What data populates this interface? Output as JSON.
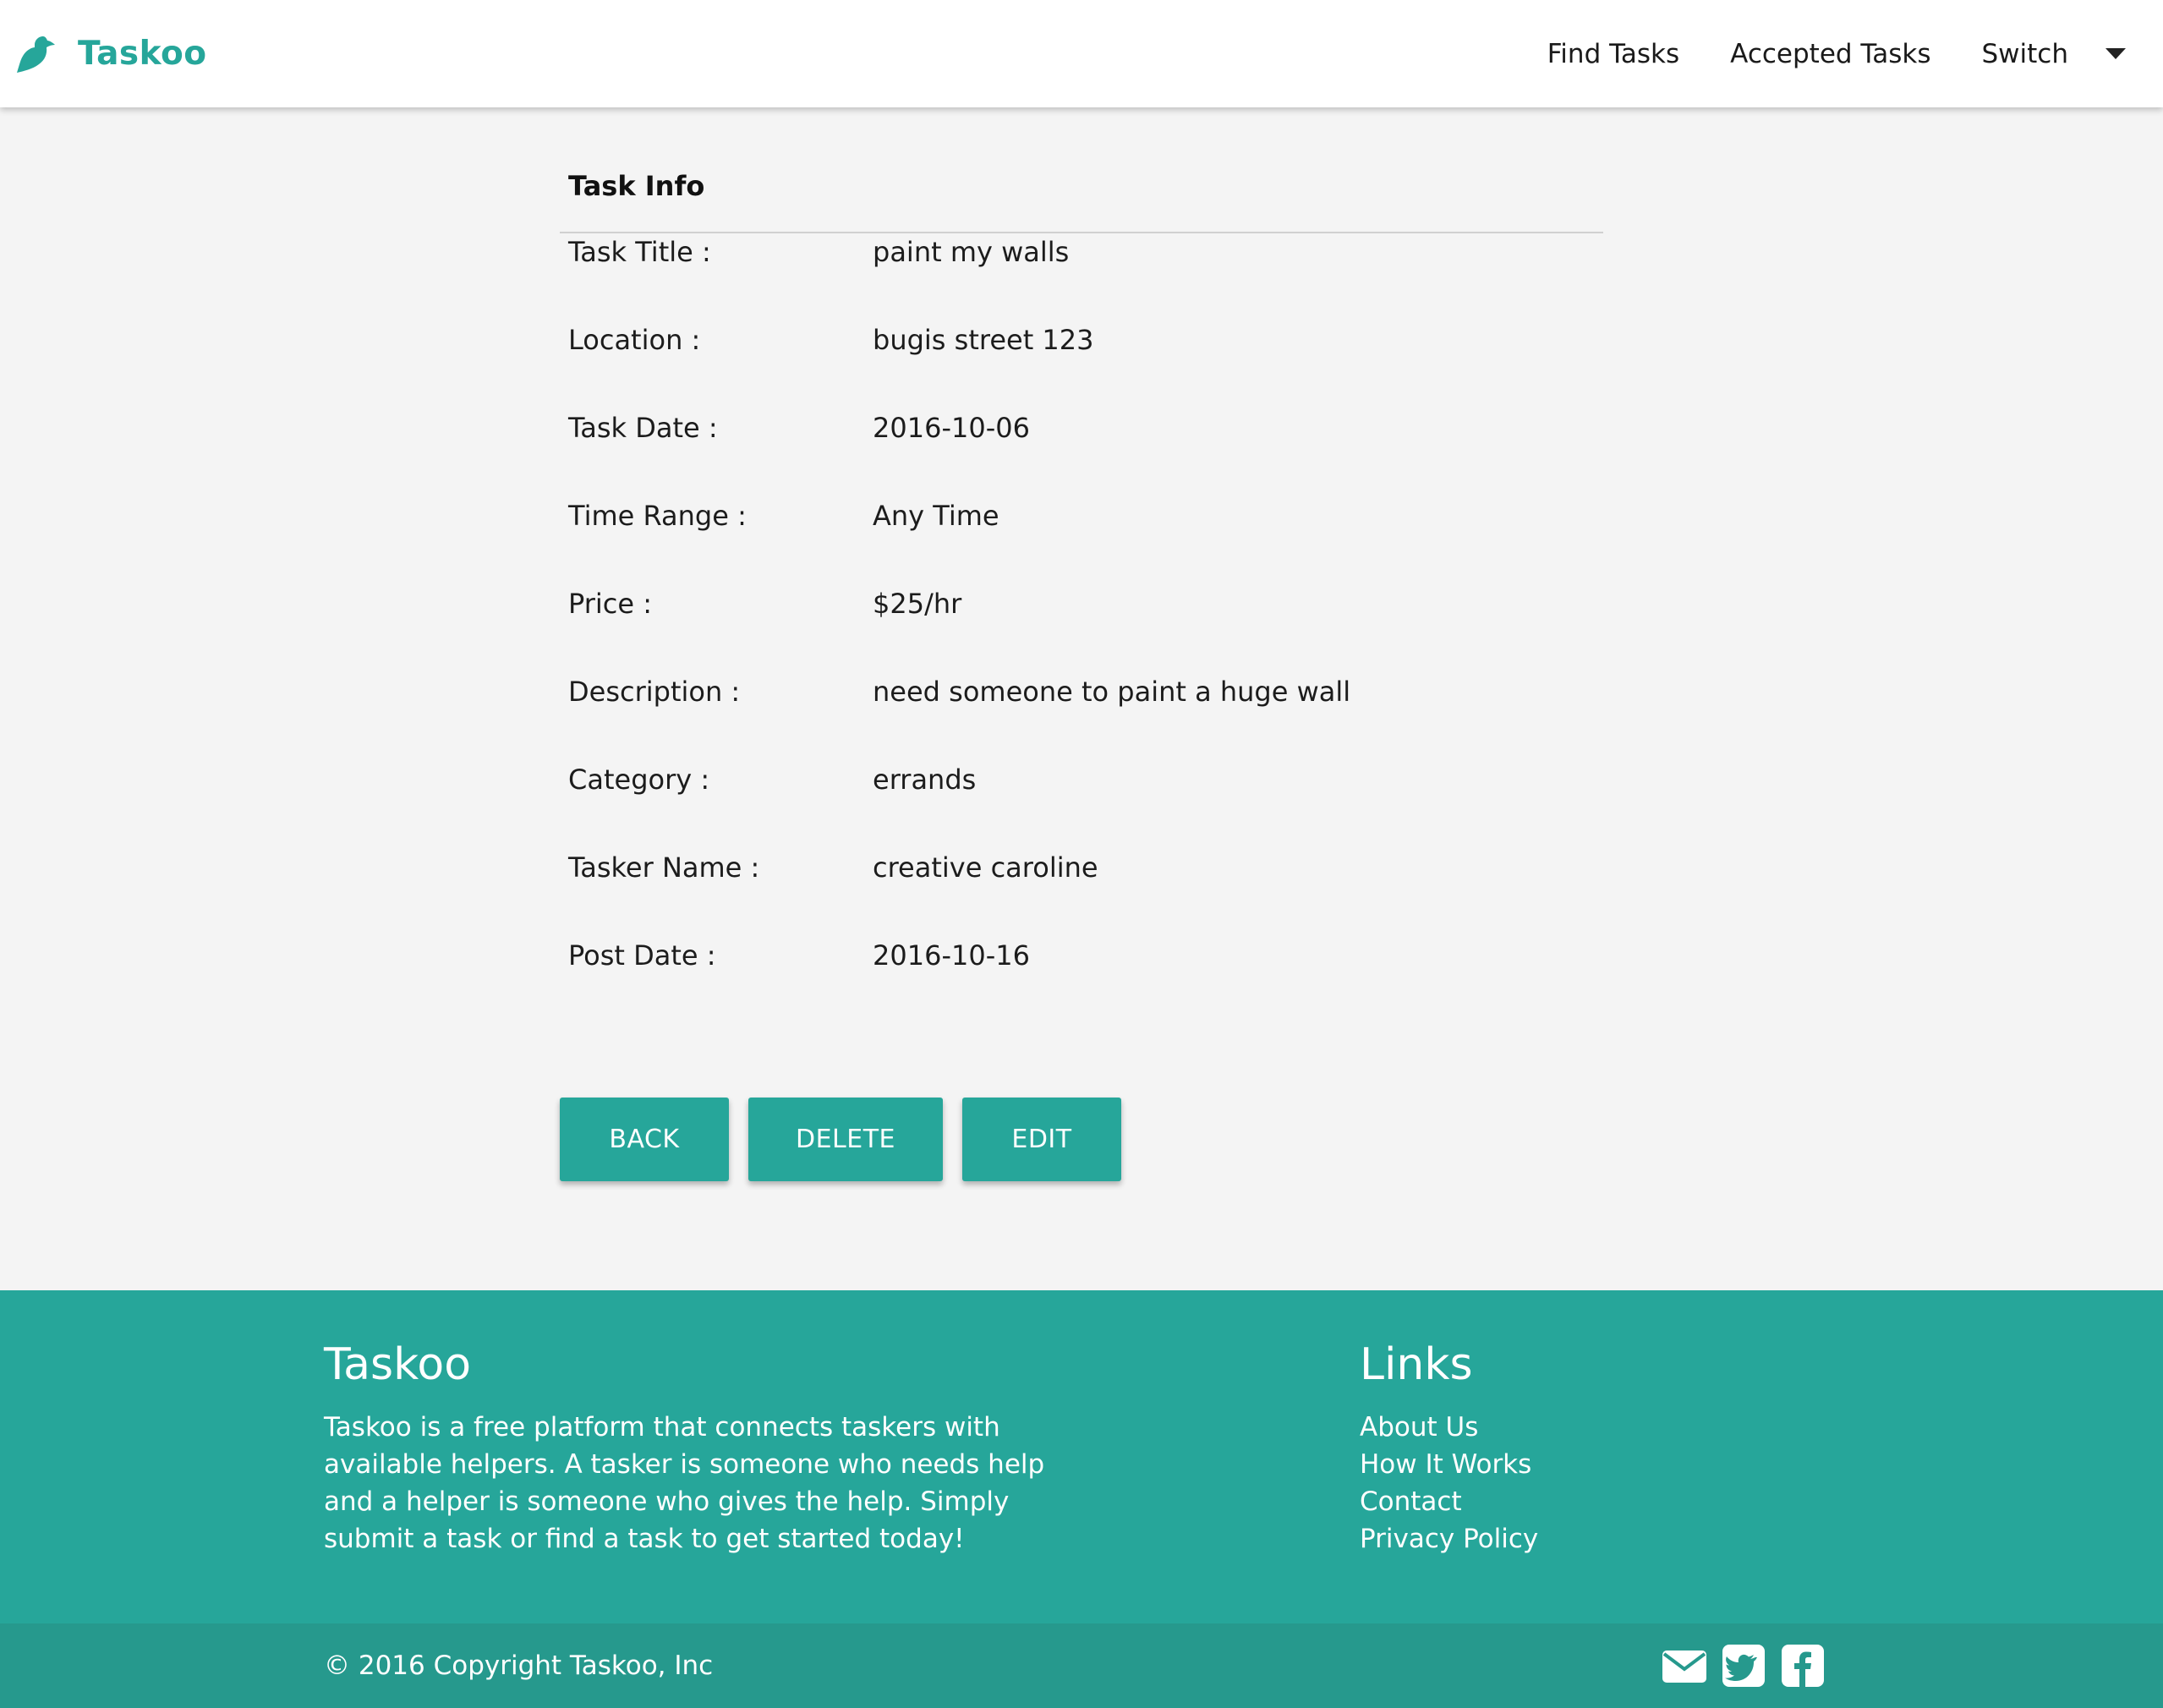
{
  "brand": {
    "name": "Taskoo",
    "icon": "bird-icon",
    "color": "#26a69a"
  },
  "nav": {
    "find_tasks": "Find Tasks",
    "accepted_tasks": "Accepted Tasks",
    "switch": "Switch"
  },
  "task_info": {
    "heading": "Task Info",
    "fields": [
      {
        "label": "Task Title :",
        "value": "paint my walls"
      },
      {
        "label": "Location :",
        "value": "bugis street 123"
      },
      {
        "label": "Task Date :",
        "value": "2016-10-06"
      },
      {
        "label": "Time Range :",
        "value": "Any Time"
      },
      {
        "label": "Price :",
        "value": "$25/hr"
      },
      {
        "label": "Description :",
        "value": "need someone to paint a huge wall"
      },
      {
        "label": "Category :",
        "value": "errands"
      },
      {
        "label": "Tasker Name :",
        "value": "creative caroline"
      },
      {
        "label": "Post Date :",
        "value": "2016-10-16"
      }
    ]
  },
  "actions": {
    "back": "BACK",
    "delete": "DELETE",
    "edit": "EDIT"
  },
  "footer": {
    "title": "Taskoo",
    "description": "Taskoo is a free platform that connects taskers with available helpers. A tasker is someone who needs help and a helper is someone who gives the help. Simply submit a task or find a task to get started today!",
    "links_title": "Links",
    "links": [
      "About Us",
      "How It Works",
      "Contact",
      "Privacy Policy"
    ],
    "copyright": "© 2016 Copyright Taskoo, Inc",
    "social_icons": [
      "envelope-icon",
      "twitter-icon",
      "facebook-icon"
    ],
    "background": "#26a69a"
  }
}
